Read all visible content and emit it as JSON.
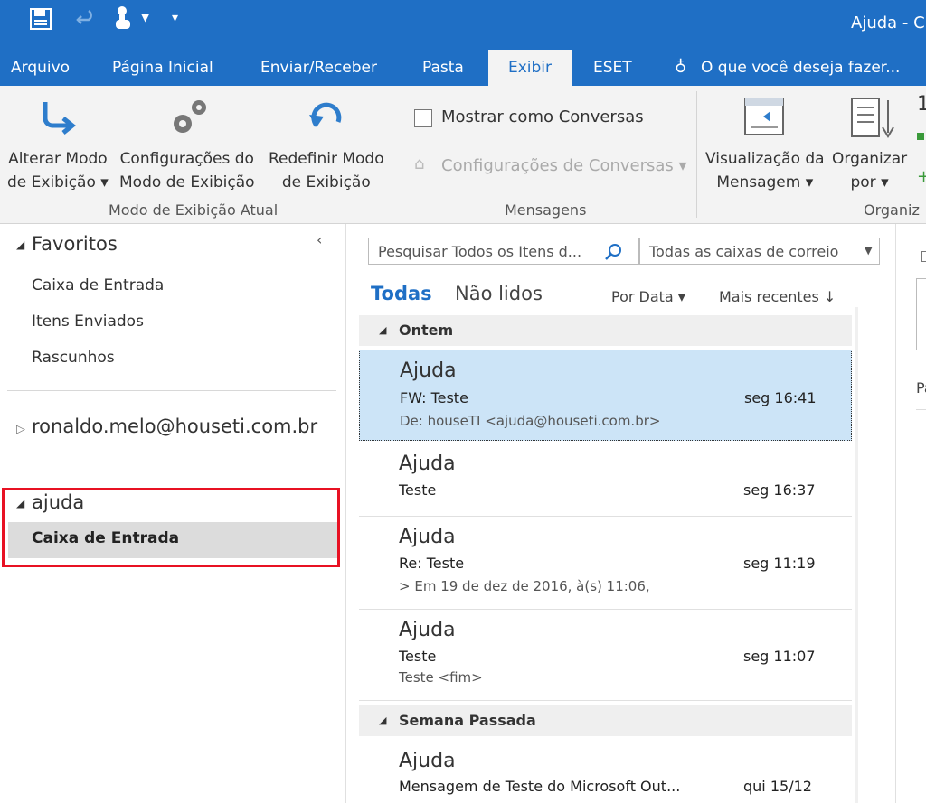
{
  "window": {
    "title": "Ajuda - C"
  },
  "tabs": [
    {
      "label": "Arquivo"
    },
    {
      "label": "Página Inicial"
    },
    {
      "label": "Enviar/Receber"
    },
    {
      "label": "Pasta"
    },
    {
      "label": "Exibir"
    },
    {
      "label": "ESET"
    }
  ],
  "tell_me": "O que você deseja fazer...",
  "ribbon": {
    "change_view": [
      "Alterar Modo",
      "de Exibição ▾"
    ],
    "view_settings": [
      "Configurações do",
      "Modo de Exibição"
    ],
    "reset_view": [
      "Redefinir Modo",
      "de Exibição"
    ],
    "group_current_view": "Modo de Exibição Atual",
    "show_conversations": "Mostrar como Conversas",
    "conversation_settings": "Configurações de Conversas ▾",
    "group_messages": "Mensagens",
    "message_preview": [
      "Visualização da",
      "Mensagem ▾"
    ],
    "arrange_by": [
      "Organizar",
      "por ▾"
    ],
    "group_arrangement": "Organiz",
    "partial_1": "1"
  },
  "nav": {
    "favorites_label": "Favoritos",
    "favorites": [
      "Caixa de Entrada",
      "Itens Enviados",
      "Rascunhos"
    ],
    "account1": "ronaldo.melo@houseti.com.br",
    "account2": "ajuda",
    "account2_inbox": "Caixa de Entrada"
  },
  "search": {
    "placeholder": "Pesquisar Todos os Itens d...",
    "scope": "Todas as caixas de correio"
  },
  "filters": {
    "all": "Todas",
    "unread": "Não lidos",
    "sort_by": "Por Data ▾",
    "order": "Mais recentes ↓"
  },
  "groups": [
    "Ontem",
    "Semana Passada"
  ],
  "messages": [
    {
      "sender": "Ajuda",
      "subject": "FW: Teste",
      "time": "seg 16:41",
      "preview": "De: houseTI <ajuda@houseti.com.br>"
    },
    {
      "sender": "Ajuda",
      "subject": "Teste",
      "time": "seg 16:37",
      "preview": ""
    },
    {
      "sender": "Ajuda",
      "subject": "Re: Teste",
      "time": "seg 11:19",
      "preview": "> Em 19 de dez de 2016, à(s) 11:06,"
    },
    {
      "sender": "Ajuda",
      "subject": "Teste",
      "time": "seg 11:07",
      "preview": "Teste <fim>"
    },
    {
      "sender": "Ajuda",
      "subject": "Mensagem de Teste do Microsoft Out...",
      "time": "qui 15/12",
      "preview": ""
    }
  ],
  "reading_pane": {
    "partial_label": "Pa"
  },
  "colors": {
    "brand": "#1f6fc5",
    "selected_msg": "#cce4f7",
    "highlight_box": "#e81123"
  }
}
